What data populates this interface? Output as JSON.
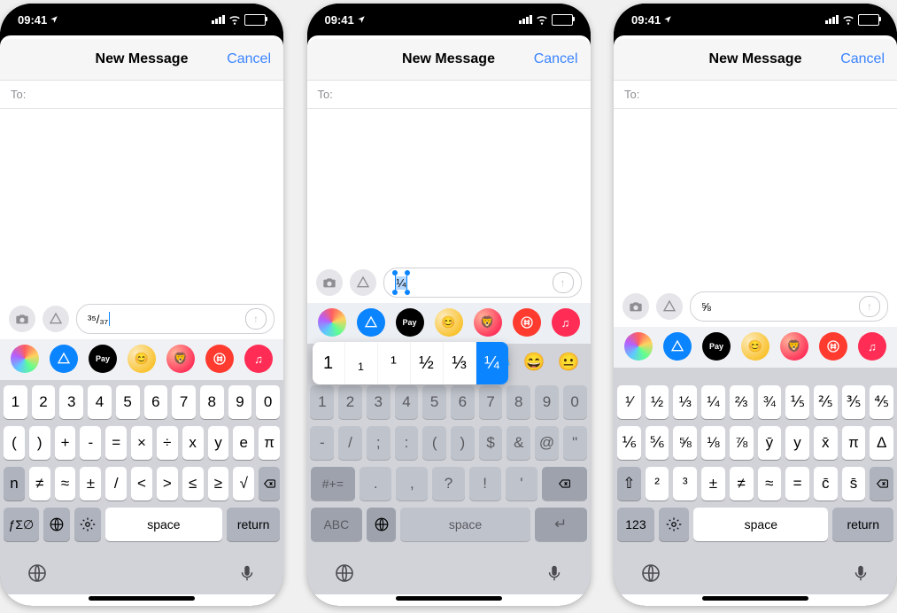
{
  "status": {
    "time": "09:41"
  },
  "nav": {
    "title": "New Message",
    "cancel": "Cancel"
  },
  "to_label": "To:",
  "apps": [
    "photos",
    "appstore",
    "applepay",
    "memoji1",
    "memoji2",
    "red1",
    "red2"
  ],
  "phone1": {
    "input_text": "³⁵/₃₇",
    "rows": [
      [
        "1",
        "2",
        "3",
        "4",
        "5",
        "6",
        "7",
        "8",
        "9",
        "0"
      ],
      [
        "(",
        ")",
        "+",
        "-",
        "=",
        "×",
        "÷",
        "x",
        "y",
        "e",
        "π"
      ],
      [
        "n",
        "≠",
        "≈",
        "±",
        "/",
        "<",
        ">",
        "≤",
        "≥",
        "√",
        "⌫"
      ]
    ],
    "bottom": {
      "sym": "ƒΣ∅",
      "globe": "globe",
      "gear": "gear",
      "space": "space",
      "return": "return"
    }
  },
  "phone2": {
    "input_text": "¼",
    "popup": [
      "1",
      "₁",
      "¹",
      "½",
      "⅓",
      "¼"
    ],
    "emoji": [
      "😂",
      "😄",
      "😐"
    ],
    "rows": [
      [
        "1",
        "2",
        "3",
        "4",
        "5",
        "6",
        "7",
        "8",
        "9",
        "0"
      ],
      [
        "-",
        "/",
        ";",
        ":",
        "(",
        ")",
        "$",
        "&",
        "@",
        "\""
      ],
      [
        "#+=",
        ".",
        ",",
        "?",
        "!",
        "'",
        "⌫"
      ]
    ],
    "bottom": {
      "abc": "ABC",
      "globe": "globe",
      "space": "space",
      "return": "↵"
    }
  },
  "phone3": {
    "input_text": "⅝",
    "rows": [
      [
        "¹∕",
        "½",
        "⅓",
        "¼",
        "⅔",
        "¾",
        "⅕",
        "⅖",
        "⅗",
        "⅘"
      ],
      [
        "⅙",
        "⅚",
        "⅝",
        "⅛",
        "⅞",
        "ȳ",
        "y",
        "x̄",
        "π",
        "Δ"
      ],
      [
        "⇧",
        "²",
        "³",
        "±",
        "≠",
        "≈",
        "=",
        "c̄",
        "s̄",
        "⌫"
      ]
    ],
    "bottom": {
      "num": "123",
      "gear": "gear",
      "space": "space",
      "return": "return"
    }
  }
}
